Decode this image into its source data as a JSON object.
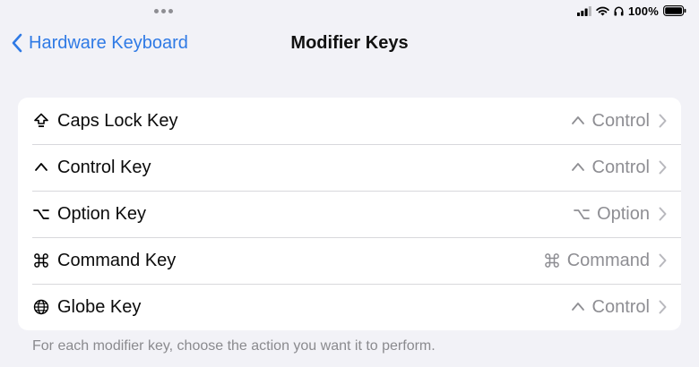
{
  "status_bar": {
    "battery_percent": "100%"
  },
  "nav": {
    "back_label": "Hardware Keyboard",
    "title": "Modifier Keys"
  },
  "rows": [
    {
      "label": "Caps Lock Key",
      "value": "Control",
      "icon": "caps-lock-icon",
      "value_icon": "control-icon"
    },
    {
      "label": "Control Key",
      "value": "Control",
      "icon": "control-icon",
      "value_icon": "control-icon"
    },
    {
      "label": "Option Key",
      "value": "Option",
      "icon": "option-icon",
      "value_icon": "option-icon"
    },
    {
      "label": "Command Key",
      "value": "Command",
      "icon": "command-icon",
      "value_icon": "command-icon"
    },
    {
      "label": "Globe Key",
      "value": "Control",
      "icon": "globe-icon",
      "value_icon": "control-icon"
    }
  ],
  "footer_note": "For each modifier key, choose the action you want it to perform.",
  "colors": {
    "accent": "#2f7ae5",
    "background": "#f2f2f7",
    "secondary_text": "#8e8e93"
  }
}
